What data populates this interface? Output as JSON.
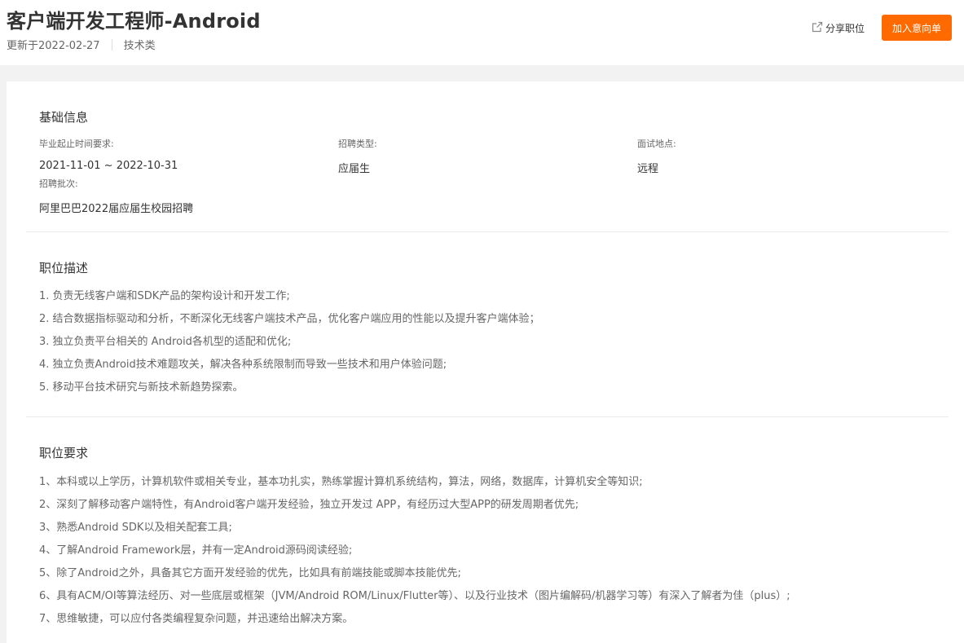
{
  "header": {
    "title": "客户端开发工程师-Android",
    "updated": "更新于2022-02-27",
    "category": "技术类",
    "share_label": "分享职位",
    "add_button_label": "加入意向单"
  },
  "basic_info": {
    "section_title": "基础信息",
    "grad_time_label": "毕业起止时间要求:",
    "grad_time_value": "2021-11-01 ~ 2022-10-31",
    "recruit_type_label": "招聘类型:",
    "recruit_type_value": "应届生",
    "interview_location_label": "面试地点:",
    "interview_location_value": "远程",
    "batch_label": "招聘批次:",
    "batch_value": "阿里巴巴2022届应届生校园招聘"
  },
  "description": {
    "section_title": "职位描述",
    "items": [
      "1. 负责无线客户端和SDK产品的架构设计和开发工作;",
      "2. 结合数据指标驱动和分析，不断深化无线客户端技术产品，优化客户端应用的性能以及提升客户端体验；",
      "3. 独立负责平台相关的 Android各机型的适配和优化;",
      "4. 独立负责Android技术难题攻关，解决各种系统限制而导致一些技术和用户体验问题;",
      "5. 移动平台技术研究与新技术新趋势探索。"
    ]
  },
  "requirements": {
    "section_title": "职位要求",
    "items": [
      "1、本科或以上学历，计算机软件或相关专业，基本功扎实，熟练掌握计算机系统结构，算法，网络，数据库，计算机安全等知识;",
      "2、深刻了解移动客户端特性，有Android客户端开发经验，独立开发过 APP，有经历过大型APP的研发周期者优先;",
      "3、熟悉Android SDK以及相关配套工具;",
      "4、了解Android Framework层，并有一定Android源码阅读经验;",
      "5、除了Android之外，具备其它方面开发经验的优先，比如具有前端技能或脚本技能优先;",
      "6、具有ACM/OI等算法经历、对一些底层或框架（JVM/Android ROM/Linux/Flutter等）、以及行业技术（图片编解码/机器学习等）有深入了解者为佳（plus）;",
      "7、思维敏捷，可以应付各类编程复杂问题，并迅速给出解决方案。"
    ]
  },
  "colors": {
    "accent": "#ff6a00",
    "page_background": "#f2f2f2",
    "card_background": "#ffffff"
  }
}
